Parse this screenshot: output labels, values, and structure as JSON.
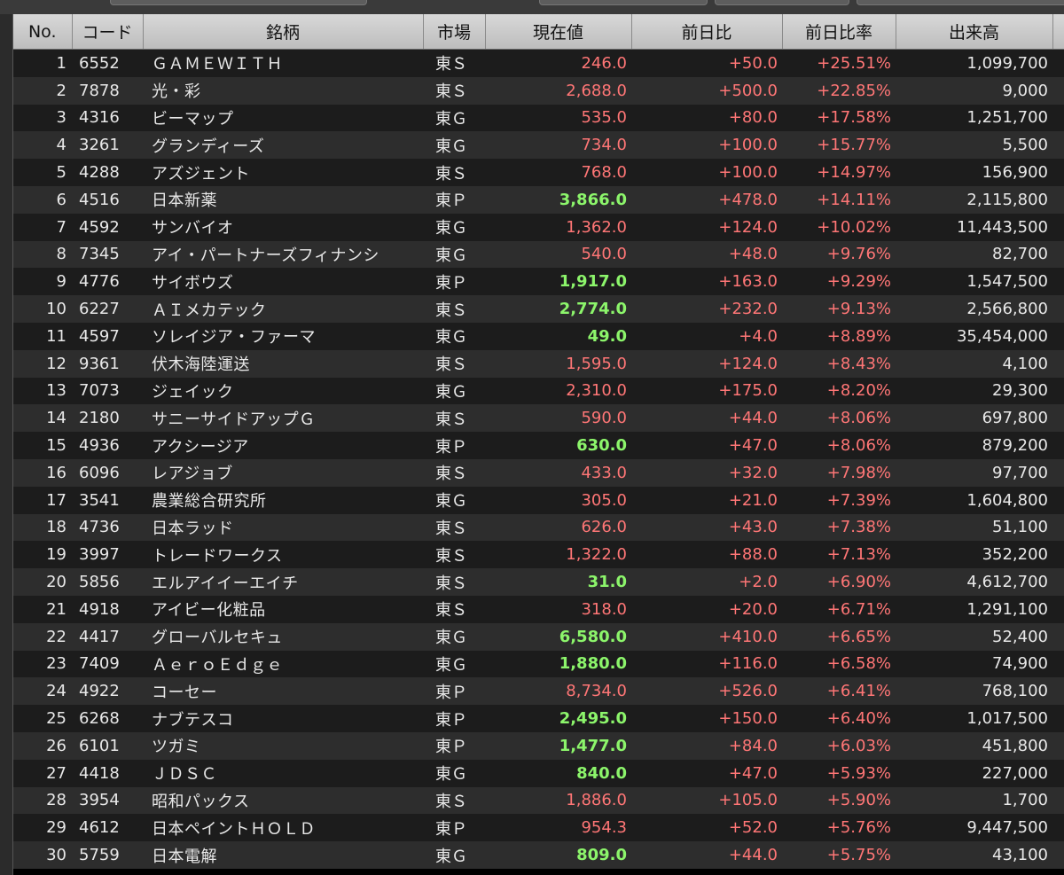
{
  "colors": {
    "up_red": "#ff7676",
    "green": "#8cf56b",
    "header_bg": "#c9c9c9",
    "row_odd": "#1c1c1c",
    "row_even": "#2d2d2d"
  },
  "headers": [
    "No.",
    "コード",
    "銘柄",
    "市場",
    "現在値",
    "前日比",
    "前日比率",
    "出来高",
    ""
  ],
  "rows": [
    {
      "no": "1",
      "code": "6552",
      "name": "ＧＡＭＥＷＩＴＨ",
      "market": "東Ｓ",
      "price": "246.0",
      "price_color": "red",
      "change": "+50.0",
      "pct": "+25.51%",
      "volume": "1,099,700"
    },
    {
      "no": "2",
      "code": "7878",
      "name": "光・彩",
      "market": "東Ｓ",
      "price": "2,688.0",
      "price_color": "red",
      "change": "+500.0",
      "pct": "+22.85%",
      "volume": "9,000"
    },
    {
      "no": "3",
      "code": "4316",
      "name": "ビーマップ",
      "market": "東Ｇ",
      "price": "535.0",
      "price_color": "red",
      "change": "+80.0",
      "pct": "+17.58%",
      "volume": "1,251,700"
    },
    {
      "no": "4",
      "code": "3261",
      "name": "グランディーズ",
      "market": "東Ｇ",
      "price": "734.0",
      "price_color": "red",
      "change": "+100.0",
      "pct": "+15.77%",
      "volume": "5,500"
    },
    {
      "no": "5",
      "code": "4288",
      "name": "アズジェント",
      "market": "東Ｓ",
      "price": "768.0",
      "price_color": "red",
      "change": "+100.0",
      "pct": "+14.97%",
      "volume": "156,900"
    },
    {
      "no": "6",
      "code": "4516",
      "name": "日本新薬",
      "market": "東Ｐ",
      "price": "3,866.0",
      "price_color": "green",
      "change": "+478.0",
      "pct": "+14.11%",
      "volume": "2,115,800"
    },
    {
      "no": "7",
      "code": "4592",
      "name": "サンバイオ",
      "market": "東Ｇ",
      "price": "1,362.0",
      "price_color": "red",
      "change": "+124.0",
      "pct": "+10.02%",
      "volume": "11,443,500"
    },
    {
      "no": "8",
      "code": "7345",
      "name": "アイ・パートナーズフィナンシ",
      "market": "東Ｇ",
      "price": "540.0",
      "price_color": "red",
      "change": "+48.0",
      "pct": "+9.76%",
      "volume": "82,700"
    },
    {
      "no": "9",
      "code": "4776",
      "name": "サイボウズ",
      "market": "東Ｐ",
      "price": "1,917.0",
      "price_color": "green",
      "change": "+163.0",
      "pct": "+9.29%",
      "volume": "1,547,500"
    },
    {
      "no": "10",
      "code": "6227",
      "name": "ＡＩメカテック",
      "market": "東Ｓ",
      "price": "2,774.0",
      "price_color": "green",
      "change": "+232.0",
      "pct": "+9.13%",
      "volume": "2,566,800"
    },
    {
      "no": "11",
      "code": "4597",
      "name": "ソレイジア・ファーマ",
      "market": "東Ｇ",
      "price": "49.0",
      "price_color": "green",
      "change": "+4.0",
      "pct": "+8.89%",
      "volume": "35,454,000"
    },
    {
      "no": "12",
      "code": "9361",
      "name": "伏木海陸運送",
      "market": "東Ｓ",
      "price": "1,595.0",
      "price_color": "red",
      "change": "+124.0",
      "pct": "+8.43%",
      "volume": "4,100"
    },
    {
      "no": "13",
      "code": "7073",
      "name": "ジェイック",
      "market": "東Ｇ",
      "price": "2,310.0",
      "price_color": "red",
      "change": "+175.0",
      "pct": "+8.20%",
      "volume": "29,300"
    },
    {
      "no": "14",
      "code": "2180",
      "name": "サニーサイドアップＧ",
      "market": "東Ｓ",
      "price": "590.0",
      "price_color": "red",
      "change": "+44.0",
      "pct": "+8.06%",
      "volume": "697,800"
    },
    {
      "no": "15",
      "code": "4936",
      "name": "アクシージア",
      "market": "東Ｐ",
      "price": "630.0",
      "price_color": "green",
      "change": "+47.0",
      "pct": "+8.06%",
      "volume": "879,200"
    },
    {
      "no": "16",
      "code": "6096",
      "name": "レアジョブ",
      "market": "東Ｓ",
      "price": "433.0",
      "price_color": "red",
      "change": "+32.0",
      "pct": "+7.98%",
      "volume": "97,700"
    },
    {
      "no": "17",
      "code": "3541",
      "name": "農業総合研究所",
      "market": "東Ｇ",
      "price": "305.0",
      "price_color": "red",
      "change": "+21.0",
      "pct": "+7.39%",
      "volume": "1,604,800"
    },
    {
      "no": "18",
      "code": "4736",
      "name": "日本ラッド",
      "market": "東Ｓ",
      "price": "626.0",
      "price_color": "red",
      "change": "+43.0",
      "pct": "+7.38%",
      "volume": "51,100"
    },
    {
      "no": "19",
      "code": "3997",
      "name": "トレードワークス",
      "market": "東Ｓ",
      "price": "1,322.0",
      "price_color": "red",
      "change": "+88.0",
      "pct": "+7.13%",
      "volume": "352,200"
    },
    {
      "no": "20",
      "code": "5856",
      "name": "エルアイイーエイチ",
      "market": "東Ｓ",
      "price": "31.0",
      "price_color": "green",
      "change": "+2.0",
      "pct": "+6.90%",
      "volume": "4,612,700"
    },
    {
      "no": "21",
      "code": "4918",
      "name": "アイビー化粧品",
      "market": "東Ｓ",
      "price": "318.0",
      "price_color": "red",
      "change": "+20.0",
      "pct": "+6.71%",
      "volume": "1,291,100"
    },
    {
      "no": "22",
      "code": "4417",
      "name": "グローバルセキュ",
      "market": "東Ｇ",
      "price": "6,580.0",
      "price_color": "green",
      "change": "+410.0",
      "pct": "+6.65%",
      "volume": "52,400"
    },
    {
      "no": "23",
      "code": "7409",
      "name": "ＡｅｒｏＥｄｇｅ",
      "market": "東Ｇ",
      "price": "1,880.0",
      "price_color": "green",
      "change": "+116.0",
      "pct": "+6.58%",
      "volume": "74,900"
    },
    {
      "no": "24",
      "code": "4922",
      "name": "コーセー",
      "market": "東Ｐ",
      "price": "8,734.0",
      "price_color": "red",
      "change": "+526.0",
      "pct": "+6.41%",
      "volume": "768,100"
    },
    {
      "no": "25",
      "code": "6268",
      "name": "ナブテスコ",
      "market": "東Ｐ",
      "price": "2,495.0",
      "price_color": "green",
      "change": "+150.0",
      "pct": "+6.40%",
      "volume": "1,017,500"
    },
    {
      "no": "26",
      "code": "6101",
      "name": "ツガミ",
      "market": "東Ｐ",
      "price": "1,477.0",
      "price_color": "green",
      "change": "+84.0",
      "pct": "+6.03%",
      "volume": "451,800"
    },
    {
      "no": "27",
      "code": "4418",
      "name": "ＪＤＳＣ",
      "market": "東Ｇ",
      "price": "840.0",
      "price_color": "green",
      "change": "+47.0",
      "pct": "+5.93%",
      "volume": "227,000"
    },
    {
      "no": "28",
      "code": "3954",
      "name": "昭和パックス",
      "market": "東Ｓ",
      "price": "1,886.0",
      "price_color": "red",
      "change": "+105.0",
      "pct": "+5.90%",
      "volume": "1,700"
    },
    {
      "no": "29",
      "code": "4612",
      "name": "日本ペイントＨＯＬＤ",
      "market": "東Ｐ",
      "price": "954.3",
      "price_color": "red",
      "change": "+52.0",
      "pct": "+5.76%",
      "volume": "9,447,500"
    },
    {
      "no": "30",
      "code": "5759",
      "name": "日本電解",
      "market": "東Ｇ",
      "price": "809.0",
      "price_color": "green",
      "change": "+44.0",
      "pct": "+5.75%",
      "volume": "43,100"
    }
  ]
}
